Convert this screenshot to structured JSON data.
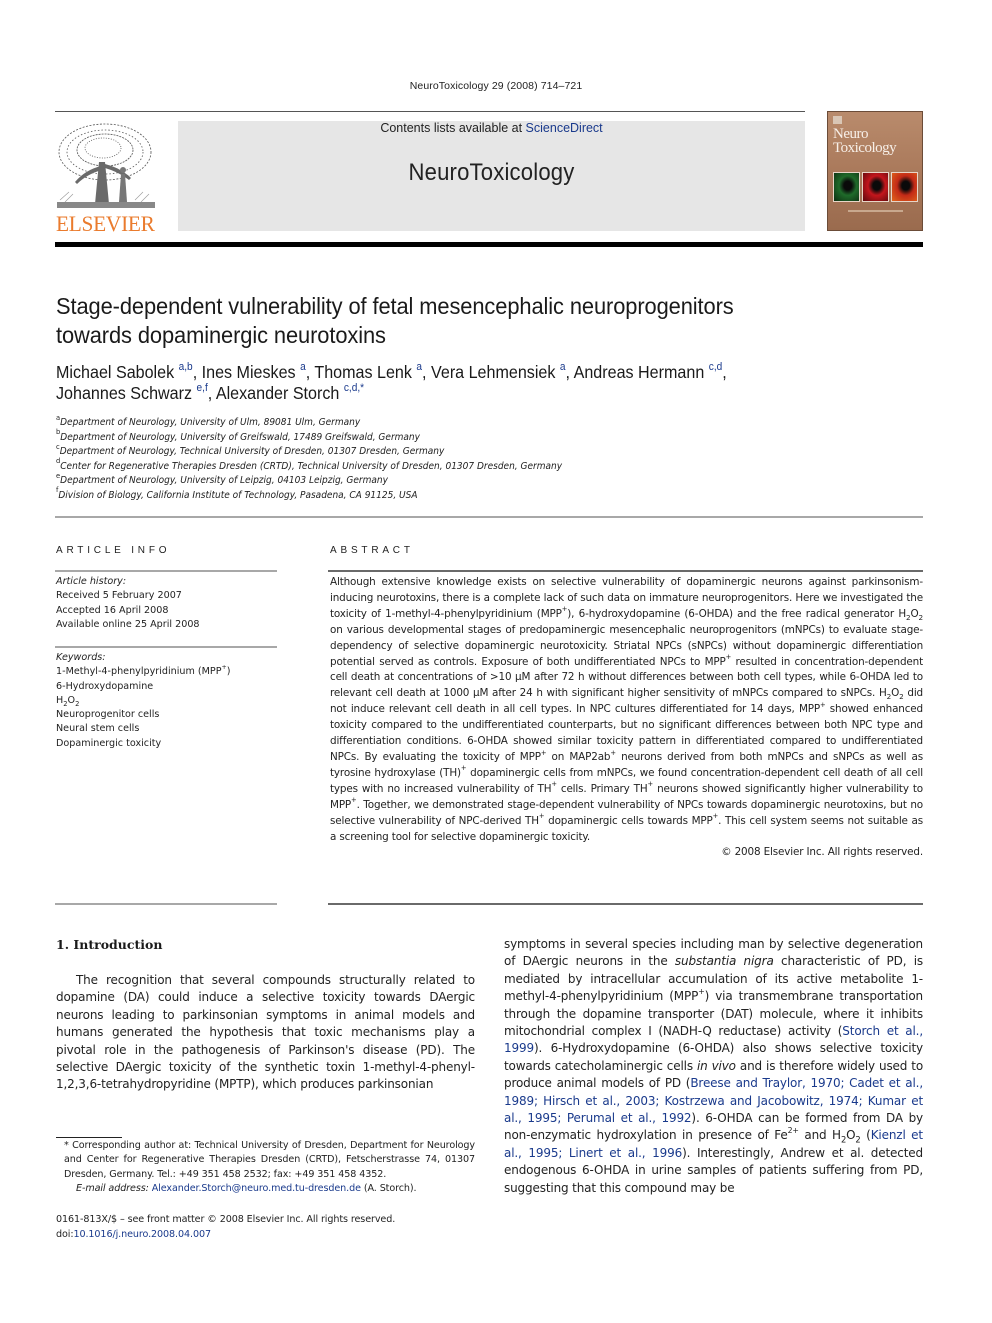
{
  "journal_reference": "NeuroToxicology 29 (2008) 714–721",
  "header": {
    "publisher_logo_text": "ELSEVIER",
    "contents_prefix": "Contents lists available at ",
    "contents_link": "ScienceDirect",
    "journal_title": "NeuroToxicology",
    "cover_title_line1": "Neuro",
    "cover_title_line2": "Toxicology",
    "colors": {
      "publisher_orange": "#ea7b2d",
      "link_blue": "#1a3a8c",
      "banner_gray": "#e6e6e6",
      "cover_brown": "#a77658"
    }
  },
  "article": {
    "title_line1": "Stage-dependent vulnerability of fetal mesencephalic neuroprogenitors",
    "title_line2": "towards dopaminergic neurotoxins",
    "authors": [
      {
        "name": "Michael Sabolek",
        "affil": "a,b",
        "sep": ", "
      },
      {
        "name": "Ines Mieskes",
        "affil": "a",
        "sep": ", "
      },
      {
        "name": "Thomas Lenk",
        "affil": "a",
        "sep": ", "
      },
      {
        "name": "Vera Lehmensiek",
        "affil": "a",
        "sep": ", "
      },
      {
        "name": "Andreas Hermann",
        "affil": "c,d",
        "sep": ","
      },
      {
        "name": "Johannes Schwarz",
        "affil": "e,f",
        "sep": ", "
      },
      {
        "name": "Alexander Storch",
        "affil": "c,d,*",
        "sep": ""
      }
    ],
    "affiliations": [
      {
        "key": "a",
        "text": "Department of Neurology, University of Ulm, 89081 Ulm, Germany"
      },
      {
        "key": "b",
        "text": "Department of Neurology, University of Greifswald, 17489 Greifswald, Germany"
      },
      {
        "key": "c",
        "text": "Department of Neurology, Technical University of Dresden, 01307 Dresden, Germany"
      },
      {
        "key": "d",
        "text": "Center for Regenerative Therapies Dresden (CRTD), Technical University of Dresden, 01307 Dresden, Germany"
      },
      {
        "key": "e",
        "text": "Department of Neurology, University of Leipzig, 04103 Leipzig, Germany"
      },
      {
        "key": "f",
        "text": "Division of Biology, California Institute of Technology, Pasadena, CA 91125, USA"
      }
    ]
  },
  "article_info": {
    "heading": "ARTICLE INFO",
    "history_label": "Article history:",
    "history": [
      "Received 5 February 2007",
      "Accepted 16 April 2008",
      "Available online 25 April 2008"
    ],
    "keywords_label": "Keywords:",
    "keywords": [
      "1-Methyl-4-phenylpyridinium (MPP+)",
      "6-Hydroxydopamine",
      "H2O2",
      "Neuroprogenitor cells",
      "Neural stem cells",
      "Dopaminergic toxicity"
    ]
  },
  "abstract": {
    "heading": "ABSTRACT",
    "text": "Although extensive knowledge exists on selective vulnerability of dopaminergic neurons against parkinsonism-inducing neurotoxins, there is a complete lack of such data on immature neuroprogenitors. Here we investigated the toxicity of 1-methyl-4-phenylpyridinium (MPP+), 6-hydroxydopamine (6-OHDA) and the free radical generator H2O2 on various developmental stages of predopaminergic mesencephalic neuroprogenitors (mNPCs) to evaluate stage-dependency of selective dopaminergic neurotoxicity. Striatal NPCs (sNPCs) without dopaminergic differentiation potential served as controls. Exposure of both undifferentiated NPCs to MPP+ resulted in concentration-dependent cell death at concentrations of >10 μM after 72 h without differences between both cell types, while 6-OHDA led to relevant cell death at 1000 μM after 24 h with significant higher sensitivity of mNPCs compared to sNPCs. H2O2 did not induce relevant cell death in all cell types. In NPC cultures differentiated for 14 days, MPP+ showed enhanced toxicity compared to the undifferentiated counterparts, but no significant differences between both NPC type and differentiation conditions. 6-OHDA showed similar toxicity pattern in differentiated compared to undifferentiated NPCs. By evaluating the toxicity of MPP+ on MAP2ab+ neurons derived from both mNPCs and sNPCs as well as tyrosine hydroxylase (TH)+ dopaminergic cells from mNPCs, we found concentration-dependent cell death of all cell types with no increased vulnerability of TH+ cells. Primary TH+ neurons showed significantly higher vulnerability to MPP+. Together, we demonstrated stage-dependent vulnerability of NPCs towards dopaminergic neurotoxins, but no selective vulnerability of NPC-derived TH+ dopaminergic cells towards MPP+. This cell system seems not suitable as a screening tool for selective dopaminergic toxicity.",
    "copyright": "© 2008 Elsevier Inc. All rights reserved."
  },
  "introduction": {
    "heading": "1.  Introduction",
    "left_column": "The recognition that several compounds structurally related to dopamine (DA) could induce a selective toxicity towards DAergic neurons leading to parkinsonian symptoms in animal models and humans generated the hypothesis that toxic mechanisms play a pivotal role in the pathogenesis of Parkinson's disease (PD). The selective DAergic toxicity of the synthetic toxin 1-methyl-4-phenyl-1,2,3,6-tetrahydropyridine (MPTP), which produces parkinsonian",
    "right_column": {
      "t1": "symptoms in several species including man by selective degeneration of DAergic neurons in the ",
      "t1_italic": "substantia nigra",
      "t2": " characteristic of PD, is mediated by intracellular accumulation of its active metabolite 1-methyl-4-phenylpyridinium (MPP",
      "t2_sup": "+",
      "t3": ") via transmembrane transportation through the dopamine transporter (DAT) molecule, where it inhibits mitochondrial complex I (NADH-Q reductase) activity (",
      "cite1": "Storch et al., 1999",
      "t4": "). 6-Hydroxydopamine (6-OHDA) also shows selective toxicity towards catecholaminergic cells ",
      "t4_italic": "in vivo",
      "t5": " and is therefore widely used to produce animal models of PD (",
      "cite2": "Breese and Traylor, 1970; Cadet et al., 1989; Hirsch et al., 2003; Kostrzewa and Jacobowitz, 1974; Kumar et al., 1995; Perumal et al., 1992",
      "t6": "). 6-OHDA can be formed from DA by non-enzymatic hydroxylation in presence of Fe",
      "t6_sup": "2+",
      "t7": " and H",
      "t7_sub": "2",
      "t8": "O",
      "t8_sub": "2",
      "t9": " (",
      "cite3": "Kienzl et al., 1995; Linert et al., 1996",
      "t10": "). Interestingly, Andrew et al. detected endogenous 6-OHDA in urine samples of patients suffering from PD, suggesting that this compound may be"
    }
  },
  "footnote": {
    "corresponding": "* Corresponding author at: Technical University of Dresden, Department for Neurology and Center for Regenerative Therapies Dresden (CRTD), Fetscherstrasse 74, 01307 Dresden, Germany. Tel.: +49 351 458 2532; fax: +49 351 458 4352.",
    "email_label": "E-mail address: ",
    "email": "Alexander.Storch@neuro.med.tu-dresden.de",
    "email_suffix": " (A. Storch).",
    "issn_line": "0161-813X/$ – see front matter © 2008 Elsevier Inc. All rights reserved.",
    "doi_prefix": "doi:",
    "doi": "10.1016/j.neuro.2008.04.007"
  }
}
